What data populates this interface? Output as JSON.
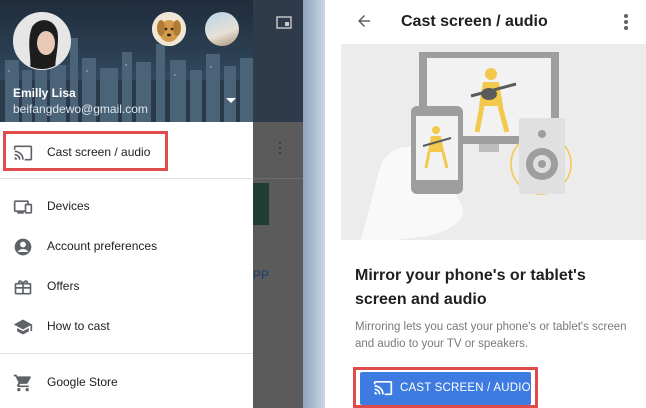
{
  "drawer": {
    "user_name": "Emilly Lisa",
    "user_email": "beifangdewo@gmail.com",
    "items": [
      {
        "label": "Cast screen / audio",
        "icon": "cast-icon"
      },
      {
        "label": "Devices",
        "icon": "devices-icon"
      },
      {
        "label": "Account preferences",
        "icon": "account-circle-icon"
      },
      {
        "label": "Offers",
        "icon": "gift-icon"
      },
      {
        "label": "How to cast",
        "icon": "school-icon"
      },
      {
        "label": "Google Store",
        "icon": "cart-icon"
      }
    ]
  },
  "background_app": {
    "partial_text": "PP"
  },
  "cast_page": {
    "title": "Cast screen / audio",
    "heading": "Mirror your phone's or tablet's screen and audio",
    "description": "Mirroring lets you cast your phone's or tablet's screen and audio to your TV or speakers.",
    "button_label": "CAST SCREEN / AUDIO"
  },
  "colors": {
    "accent_blue": "#3d7be0",
    "highlight_red": "#e04b4b",
    "hero_yellow": "#f2c94c"
  }
}
